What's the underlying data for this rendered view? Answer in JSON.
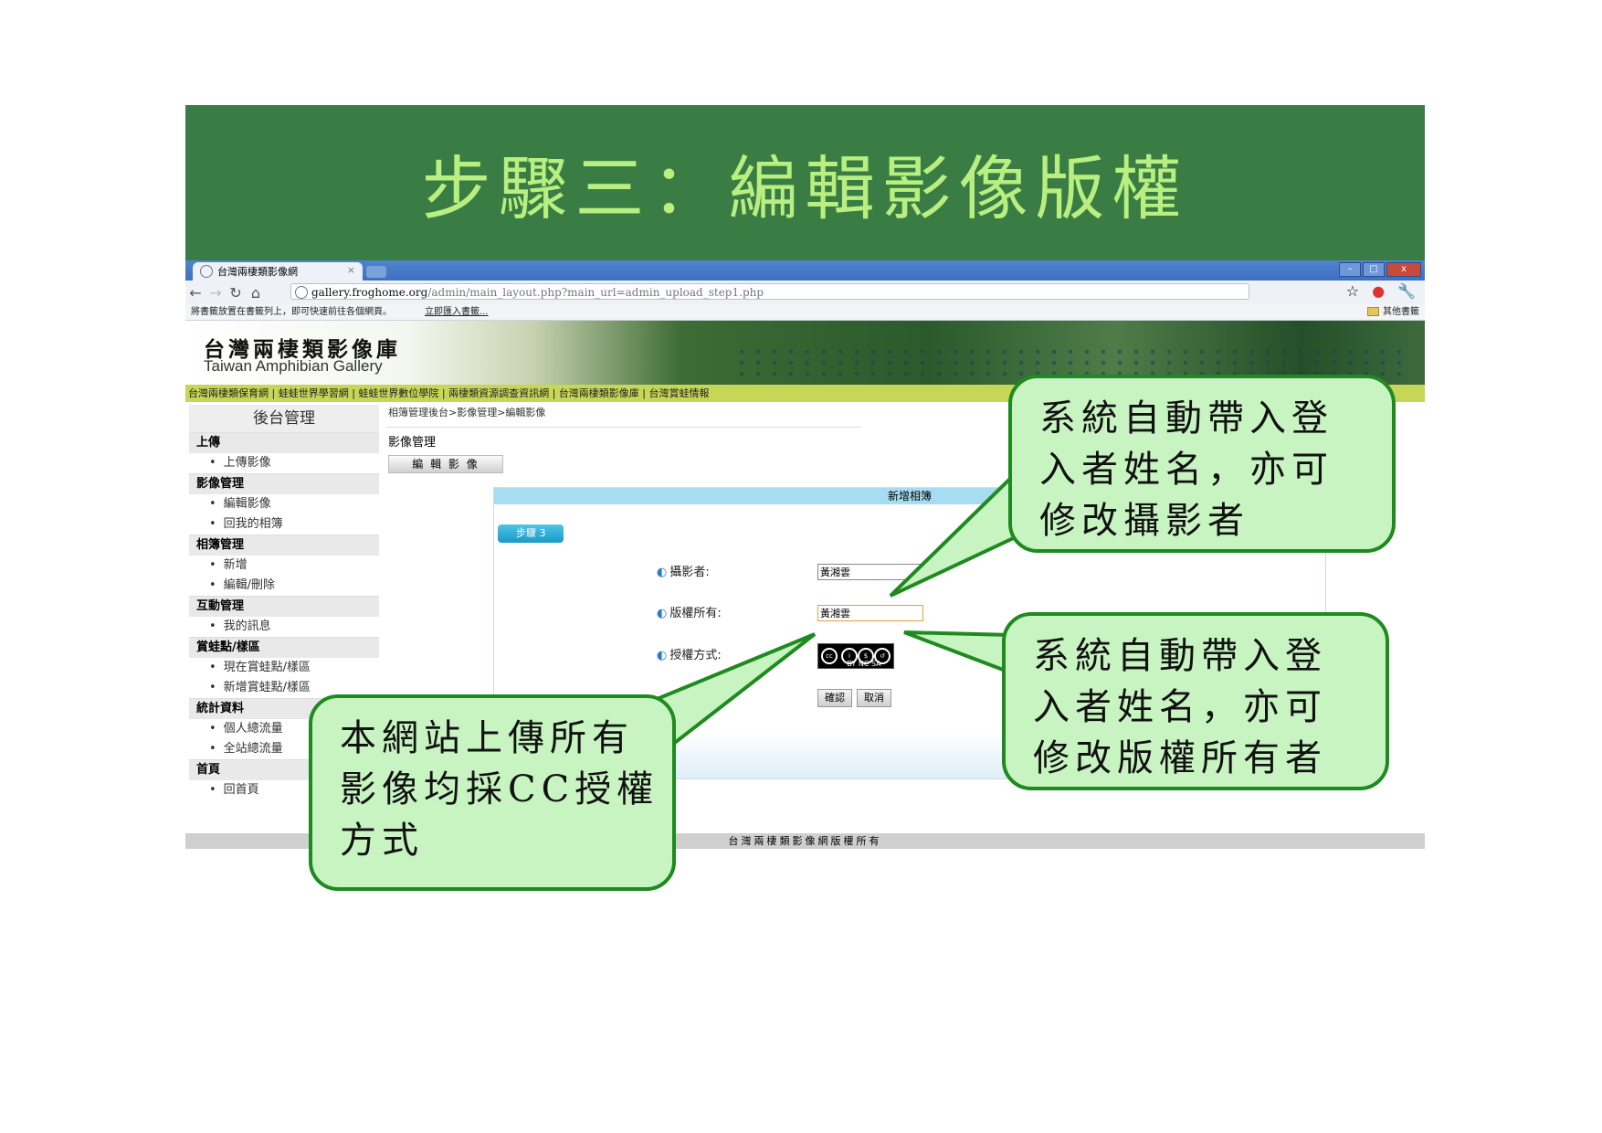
{
  "slide": {
    "title": "步驟三：編輯影像版權"
  },
  "browser": {
    "tab_title": "台灣兩棲類影像網",
    "tab_close": "×",
    "window_buttons": [
      "–",
      "□",
      "x"
    ],
    "url_host": "gallery.froghome.org",
    "url_path": "/admin/main_layout.php?main_url=admin_upload_step1.php",
    "bookmark_msg": "將書籤放置在書籤列上，即可快速前往各個網頁。",
    "bookmark_import": "立即匯入書籤...",
    "bookmark_other": "其他書籤",
    "icons": [
      "back-arrow-icon",
      "forward-arrow-icon",
      "reload-icon",
      "home-icon",
      "star-icon",
      "extension-icon",
      "wrench-icon"
    ]
  },
  "site": {
    "title": "台灣兩棲類影像庫",
    "subtitle": "Taiwan Amphibian Gallery",
    "nav": "台灣兩棲類保育網 | 蛙蛙世界學習網 | 蛙蛙世界數位學院 | 兩棲類資源調查資訊網 | 台灣兩棲類影像庫 | 台灣賞蛙情報"
  },
  "sidebar": {
    "heading": "後台管理",
    "sections": [
      {
        "title": "上傳",
        "items": [
          "上傳影像"
        ]
      },
      {
        "title": "影像管理",
        "items": [
          "編輯影像",
          "回我的相簿"
        ]
      },
      {
        "title": "相簿管理",
        "items": [
          "新增",
          "編輯/刪除"
        ]
      },
      {
        "title": "互動管理",
        "items": [
          "我的訊息"
        ]
      },
      {
        "title": "賞蛙點/樣區",
        "items": [
          "現在賞蛙點/樣區",
          "新增賞蛙點/樣區"
        ]
      },
      {
        "title": "統計資料",
        "items": [
          "個人總流量",
          "全站總流量"
        ]
      },
      {
        "title": "首頁",
        "items": [
          "回首頁"
        ]
      }
    ]
  },
  "main": {
    "breadcrumb": "相簿管理後台>影像管理>編輯影像",
    "section_title": "影像管理",
    "edit_button": "編 輯 影 像",
    "panel_title": "新增相簿",
    "step_label": "步驟 3",
    "form": {
      "photographer_label": "攝影者:",
      "photographer_value": "黃湘雲",
      "copyright_label": "版權所有:",
      "copyright_value": "黃湘雲",
      "license_label": "授權方式:",
      "license_badge": "BY  NC  SA",
      "confirm": "確認",
      "cancel": "取消"
    }
  },
  "footer": "台灣兩棲類影像網版權所有",
  "callouts": {
    "photographer": "系統自動帶入登\n入者姓名，亦可\n修改攝影者",
    "copyright": "系統自動帶入登\n入者姓名，亦可\n修改版權所有者",
    "license": "本網站上傳所有\n影像均採CC授權\n方式"
  },
  "colors": {
    "header_green": "#3a7d44",
    "title_green": "#b8ef80",
    "bubble_fill": "#c8f4c2",
    "bubble_border": "#1f8a1f",
    "nav_yellow": "#c6d656"
  }
}
